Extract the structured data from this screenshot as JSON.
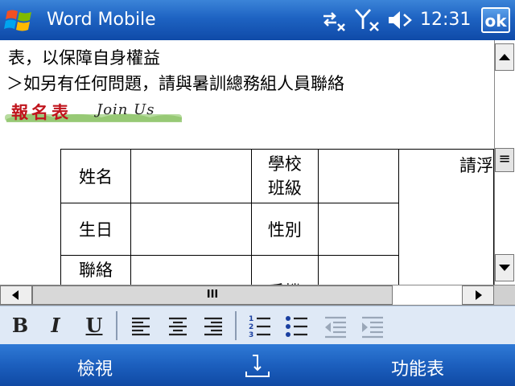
{
  "titlebar": {
    "app_title": "Word Mobile",
    "clock": "12:31",
    "ok_label": "ok",
    "icons": [
      "windows-start-logo",
      "connectivity-icon",
      "signal-off-icon",
      "volume-muted-icon"
    ]
  },
  "document": {
    "line1": "表，以保障自身權益",
    "line2": "＞如另有任何問題，請與暑訓總務組人員聯絡",
    "banner_cn": "報名表",
    "banner_en": "Join Us",
    "table": {
      "r1c1": "姓名",
      "r1c3a": "學校",
      "r1c3b": "班級",
      "r1c5": "請浮",
      "r2c1": "生日",
      "r2c3": "性別",
      "r3c1": "聯絡",
      "r3c3": "手機"
    }
  },
  "scrollbars": {
    "grip": "≡",
    "hgrip": "III"
  },
  "toolbar": {
    "bold": "B",
    "italic": "I",
    "underline": "U",
    "icons": [
      "align-left-icon",
      "align-center-icon",
      "align-right-icon",
      "numbered-list-icon",
      "bullet-list-icon",
      "decrease-indent-icon",
      "increase-indent-icon"
    ]
  },
  "softkeys": {
    "left": "檢視",
    "right": "功能表"
  },
  "colors": {
    "titlebar_blue": "#1e63c2",
    "toolbar_bg": "#dfe9f6",
    "banner_red": "#c0141c"
  }
}
